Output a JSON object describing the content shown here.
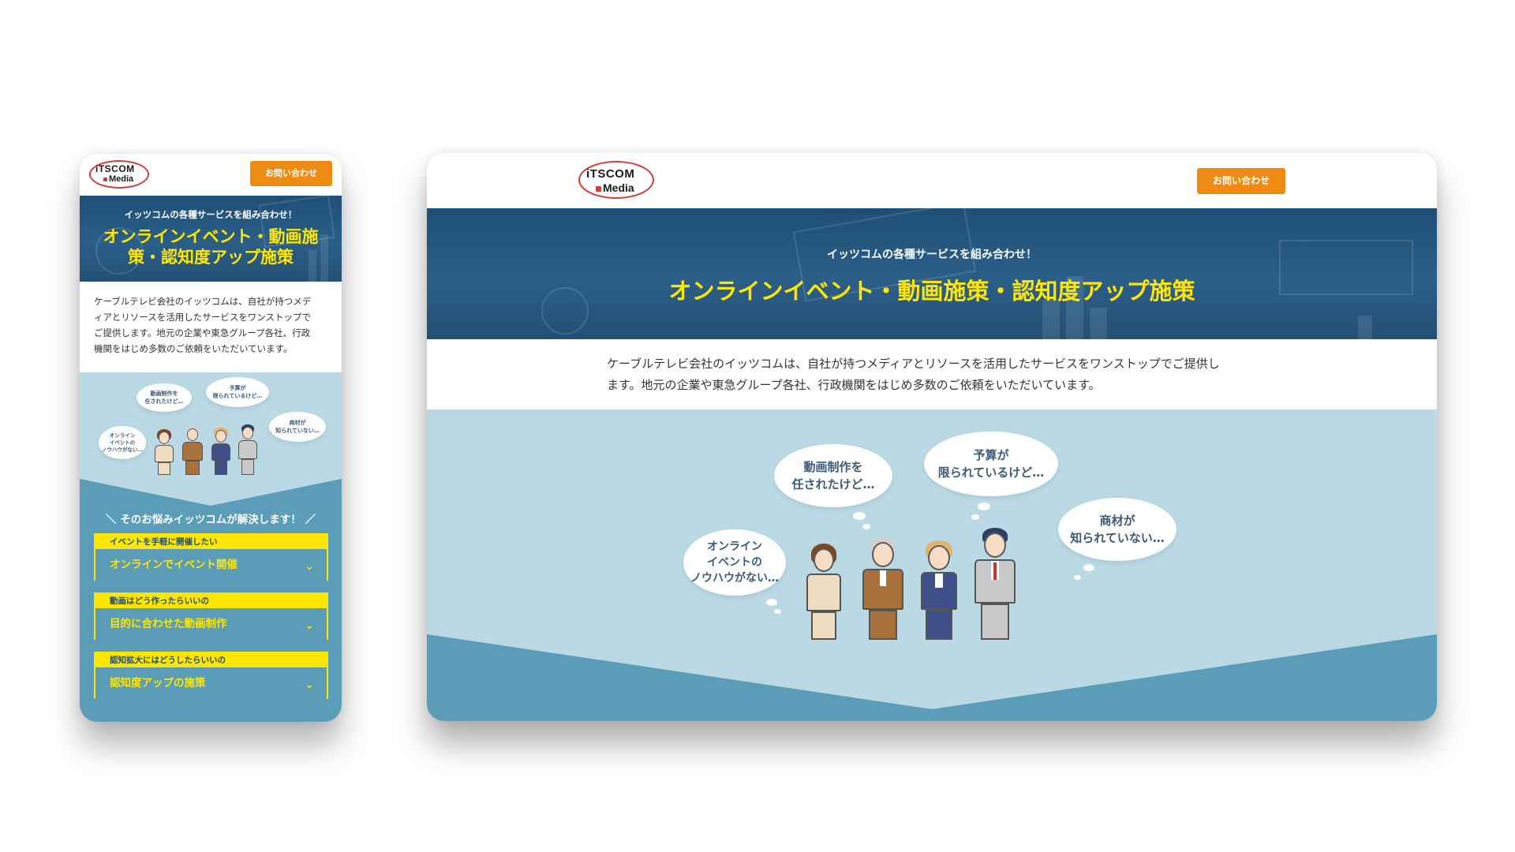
{
  "logo": {
    "line1": "iTSCOM",
    "line2": "Media"
  },
  "header": {
    "contact_label": "お問い合わせ"
  },
  "hero": {
    "subtitle": "イッツコムの各種サービスを組み合わせ！",
    "title": "オンラインイベント・動画施策・認知度アップ施策",
    "title_mobile_line1": "オンラインイベント・動画施",
    "title_mobile_line2": "策・認知度アップ施策"
  },
  "intro": {
    "desktop_line1": "ケーブルテレビ会社のイッツコムは、自社が持つメディアとリソースを活用したサービスをワンストップでご提供し",
    "desktop_line2": "ます。地元の企業や東急グループ各社、行政機関をはじめ多数のご依頼をいただいています。",
    "mobile_line1": "ケーブルテレビ会社のイッツコムは、自社が持つメデ",
    "mobile_line2": "ィアとリソースを活用したサービスをワンストップで",
    "mobile_line3": "ご提供します。地元の企業や東急グループ各社、行政",
    "mobile_line4": "機関をはじめ多数のご依頼をいただいています。"
  },
  "bubbles": {
    "video": "動画制作を\n任されたけど…",
    "budget": "予算が\n限られているけど…",
    "product": "商材が\n知られていない…",
    "online": "オンライン\nイベントの\nノウハウがない…"
  },
  "solve_heading": "＼ そのお悩みイッツコムが解決します！ ／",
  "accordions": [
    {
      "caption": "イベントを手軽に開催したい",
      "label": "オンラインでイベント開催"
    },
    {
      "caption": "動画はどう作ったらいいの",
      "label": "目的に合わせた動画制作"
    },
    {
      "caption": "認知拡大にはどうしたらいいの",
      "label": "認知度アップの施策"
    }
  ],
  "colors": {
    "accent_orange": "#ee8b12",
    "hero_navy": "#1f4f76",
    "title_yellow": "#ffe600",
    "light_blue": "#bad9e5",
    "mid_blue": "#5b9db8",
    "logo_red": "#d63a3a"
  },
  "icons": {
    "accordion_toggle": "chevron-down-icon"
  }
}
